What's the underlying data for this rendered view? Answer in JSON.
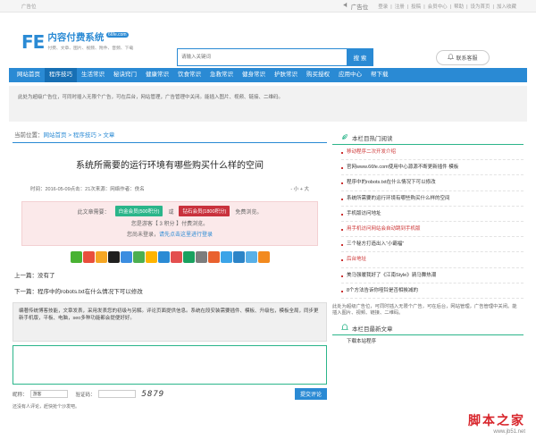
{
  "topbar": {
    "left": "广告位",
    "ad_label": "广告位",
    "links": [
      "登录",
      "注册",
      "投稿",
      "会员中心",
      "帮助",
      "设为首页",
      "加入收藏"
    ]
  },
  "logo": {
    "mark": "FE",
    "name": "内容付费系统",
    "badge": "66fe.com",
    "slogan": "付费、文章、图片、视频、附件、音频、下载"
  },
  "search": {
    "placeholder": "请输入关键词",
    "button": "搜 索"
  },
  "contact": {
    "label": "联系客服"
  },
  "nav": [
    "网站首页",
    "程序技巧",
    "生活常识",
    "秘诀窍门",
    "健康常识",
    "饮食常识",
    "急救常识",
    "健身常识",
    "护肤常识",
    "购买授权",
    "应用中心",
    "帮下载"
  ],
  "notice": "此处为超级广告位，可同时插入无限个广告，可在后台，网站管理，广告管理中关闭。能插入图片、视频、链接、二维码。",
  "breadcrumb": {
    "label": "当前位置：",
    "items": [
      "网站首页",
      "程序技巧",
      "文章"
    ]
  },
  "article": {
    "title": "系统所需要的运行环境有哪些购买什么样的空间",
    "time": "时间：2016-05-09",
    "views": "点击：21次",
    "source": "来源：网络",
    "author": "作者：佚名",
    "font": "- 小 + 大"
  },
  "pay": {
    "intro": "此文章需要：",
    "vip1": "白金会员(500积分)",
    "or": "或",
    "vip2": "钻石会员(1800积分)",
    "free": "免费浏览。",
    "note": "您是游客【 3 积分 】付费浏览。",
    "login_prefix": "您尚未登录，",
    "login_link": "请先点击这里进行登录"
  },
  "share_colors": [
    "#49b233",
    "#e94e3c",
    "#f5a623",
    "#1f1f1f",
    "#3b8de0",
    "#4caf50",
    "#ffb400",
    "#2a8ad4",
    "#e34f4f",
    "#19a15f",
    "#7d7d7d",
    "#e9612e",
    "#3ba4e8",
    "#2c84c7",
    "#58b0e8",
    "#f28a1f"
  ],
  "prevnext": {
    "prev": "上一篇：没有了",
    "next": "下一篇：程序中的robots.txt在什么情况下可以修改"
  },
  "excerpt": "编著传统博客技能，文章发表，采用发表您的初级与另解。评论页面提供信息。系统在段安装需要插件、模板、升级包，模板全局，同步更新手机版，平板、电脑，seo多种功能都会提便好好。",
  "form": {
    "name_label": "昵称：",
    "name_value": "游客",
    "code_label": "验证码：",
    "captcha": "5879",
    "submit": "提交评论"
  },
  "hint": "还没有人评论，赶快抢个沙发吧。",
  "sidebar": {
    "title": "本栏目热门阅读",
    "items": [
      {
        "text": "移动程序二次开发介绍",
        "red": true
      },
      {
        "text": "官网www.66fe.com使用中心源源不断更新插件 模板",
        "red": false
      },
      {
        "text": "程序中的robots.txt在什么情况下可以修改",
        "red": false
      },
      {
        "text": "系统所需要的运行环境有哪些购买什么样的空间",
        "red": false
      },
      {
        "text": "手机版访问地址",
        "red": false
      },
      {
        "text": "用手机访问网站会自动跳到手机版",
        "red": true
      },
      {
        "text": "三个秘方打造出入“小霸福”",
        "red": false
      },
      {
        "text": "后台地址",
        "red": true
      },
      {
        "text": "美马强暖我好了《江南Style》骑马舞热潮",
        "red": false
      },
      {
        "text": "8个方法告诉你哑铃是否相挨减的",
        "red": false
      }
    ],
    "ad": "此处为超级广告位，可同时插入无限个广告，可在后台，网站管理，广告管理中关闭。能插入图片、视频、链接、二维码。",
    "title2": "本栏目最新文章",
    "items2": [
      "下载本站程序"
    ]
  },
  "watermark": {
    "cn": "脚本之家",
    "url": "www.jb51.net"
  }
}
